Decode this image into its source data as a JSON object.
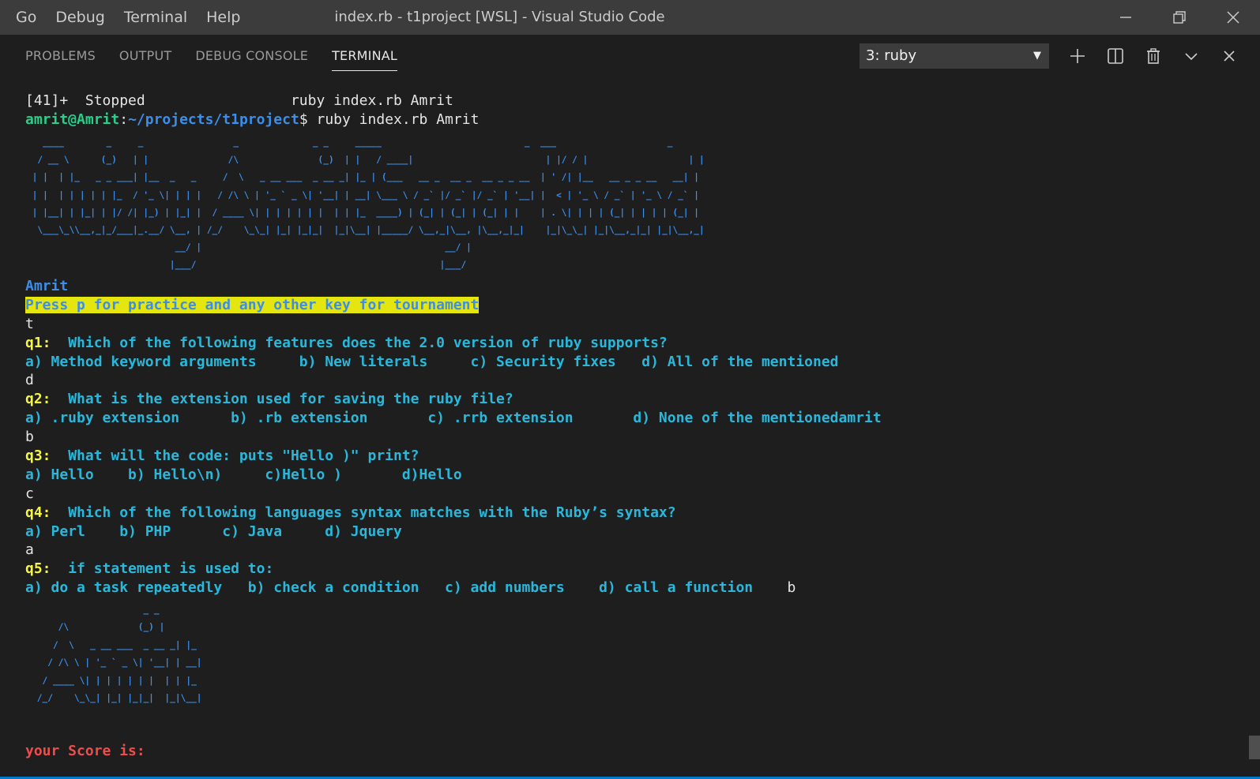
{
  "menubar": {
    "items": [
      "Go",
      "Debug",
      "Terminal",
      "Help"
    ]
  },
  "window": {
    "title": "index.rb - t1project [WSL] - Visual Studio Code"
  },
  "panel": {
    "tabs": [
      "PROBLEMS",
      "OUTPUT",
      "DEBUG CONSOLE",
      "TERMINAL"
    ],
    "active_tab": "TERMINAL",
    "terminal_select": "3: ruby"
  },
  "terminal": {
    "job_line": "[41]+  Stopped                 ruby index.rb Amrit",
    "prompt_user": "amrit@Amrit",
    "prompt_sep": ":",
    "prompt_path": "~/projects/t1project",
    "prompt_dollar": "$ ",
    "command": "ruby index.rb Amrit",
    "banner_ascii": "   ____        _     _                 _              _ _     _____                           _  ___                     _ \n  / __ \\      (_)   | |               /\\               (_)  | |   / ____|                         | |/ / |                   | |\n | |  | |_   _ _ ___| |__  _   _     /  \\   _ __ ___  _ __ _| |_ | (___   __ _  __ _  __ _ _ __  | ' /| |__   __ _ _ __   __| |\n | |  | | | | | |_  / '_ \\| | | |   / /\\ \\ | '_ ` _ \\| '__| | __| \\___ \\ / _` |/ _` |/ _` | '__| |  < | '_ \\ / _` | '_ \\ / _` |\n | |__| | |_| | |/ /| |_) | |_| |  / ____ \\| | | | | | |  | | |_  ____) | (_| | (_| | (_| | |    | . \\| | | | (_| | | | | (_| |\n  \\___\\_\\\\__,_|_/___|_.__/ \\__, | /_/    \\_\\_| |_| |_|_|  |_|\\__| |_____/ \\__,_|\\__, |\\__,_|_|    |_|\\_\\_| |_|\\__,_|_| |_|\\__,_|\n                            __/ |                                              __/ |                                          \n                           |___/                                              |___/                                           ",
    "name_line": "Amrit",
    "mode_prompt": "Press p for practice and any other key for tournament",
    "mode_input": "t",
    "questions": [
      {
        "label": "q1:",
        "text": "  Which of the following features does the 2.0 version of ruby supports?",
        "options": "a) Method keyword arguments     b) New literals     c) Security fixes   d) All of the mentioned",
        "answer": "d"
      },
      {
        "label": "q2:",
        "text": "  What is the extension used for saving the ruby file?",
        "options": "a) .ruby extension      b) .rb extension       c) .rrb extension       d) None of the mentionedamrit",
        "answer": "b"
      },
      {
        "label": "q3:",
        "text": "  What will the code: puts \"Hello )\" print?",
        "options": "a) Hello    b) Hello\\n)     c)Hello )       d)Hello",
        "answer": "c"
      },
      {
        "label": "q4:",
        "text": "  Which of the following languages syntax matches with the Ruby’s syntax?",
        "options": "a) Perl    b) PHP      c) Java     d) Jquery",
        "answer": "a"
      },
      {
        "label": "q5:",
        "text": "  if statement is used to:",
        "options": "a) do a task repeatedly   b) check a condition   c) add numbers    d) call a function",
        "answer": "b"
      }
    ],
    "q5_answer_gap": "    ",
    "name_ascii": "                     _ _   \n     /\\             (_) |  \n    /  \\   _ __ ___  _ __ _| |_ \n   / /\\ \\ | '_ ` _ \\| '__| | __|\n  / ____ \\| | | | | | |  | | |_ \n /_/    \\_\\_| |_| |_|_|  |_|\\__|",
    "score_line": "your Score is:"
  },
  "colors": {
    "titlebar": "#3c3c3c",
    "background": "#1e1e1e",
    "prompt_user": "#23d18b",
    "path": "#3b8eea",
    "question_label": "#f5f543",
    "question_text": "#29b8db",
    "score": "#f14c4c",
    "highlight_bg": "#e5e510"
  },
  "icons": [
    "minimize-icon",
    "restore-icon",
    "close-icon",
    "plus-icon",
    "split-icon",
    "trash-icon",
    "chevron-down-icon",
    "close-panel-icon"
  ]
}
